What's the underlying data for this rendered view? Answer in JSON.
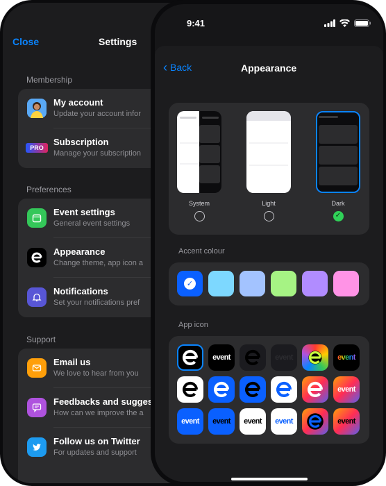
{
  "settings": {
    "close_label": "Close",
    "title": "Settings",
    "sections": [
      {
        "label": "Membership",
        "rows": [
          {
            "title": "My account",
            "subtitle": "Update your account infor",
            "icon": "avatar-icon",
            "color": "#3b82f6"
          },
          {
            "title": "Subscription",
            "subtitle": "Manage your subscription",
            "icon": "pro-badge",
            "badge": "PRO"
          }
        ]
      },
      {
        "label": "Preferences",
        "rows": [
          {
            "title": "Event settings",
            "subtitle": "General event settings",
            "icon": "calendar-icon",
            "color": "#34c759"
          },
          {
            "title": "Appearance",
            "subtitle": "Change theme, app icon a",
            "icon": "event-logo-icon",
            "color": "#000000"
          },
          {
            "title": "Notifications",
            "subtitle": "Set your notifications pref",
            "icon": "bell-icon",
            "color": "#5856d6"
          }
        ]
      },
      {
        "label": "Support",
        "rows": [
          {
            "title": "Email us",
            "subtitle": "We love to hear from you",
            "icon": "mail-icon",
            "color": "#ff9f0a"
          },
          {
            "title": "Feedbacks and sugges",
            "subtitle": "How can we improve the a",
            "icon": "feedback-icon",
            "color": "#af52de"
          },
          {
            "title": "Follow us on Twitter",
            "subtitle": "For updates and support",
            "icon": "twitter-icon",
            "color": "#1d9bf0"
          }
        ]
      }
    ]
  },
  "appearance": {
    "status_time": "9:41",
    "back_label": "Back",
    "title": "Appearance",
    "themes": [
      {
        "label": "System",
        "selected": false
      },
      {
        "label": "Light",
        "selected": false
      },
      {
        "label": "Dark",
        "selected": true
      }
    ],
    "accent_label": "Accent colour",
    "accent_colors": [
      "#0a60ff",
      "#7dd8ff",
      "#a3c3ff",
      "#a6f384",
      "#b18cff",
      "#ff93e6"
    ],
    "selected_accent_index": 0,
    "app_icon_label": "App icon",
    "app_icon_word": "event",
    "app_icon_selected_index": 0
  }
}
